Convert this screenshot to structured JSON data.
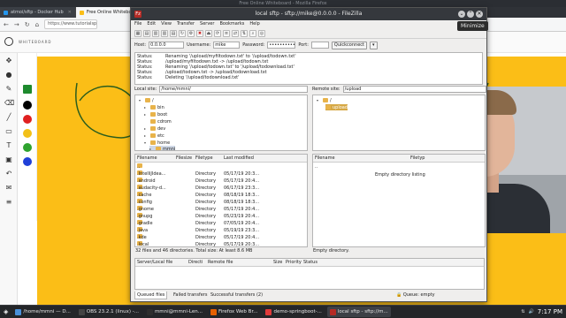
{
  "browser": {
    "title": "Free Online Whiteboard - Mozilla Firefox",
    "tabs": [
      {
        "label": "atmoi/sftp - Docker Hub",
        "active": false
      },
      {
        "label": "Free Online Whiteboard",
        "active": true
      }
    ],
    "url": "https://www.tutorialspo"
  },
  "whiteboard": {
    "brand": "WHITEBOARD",
    "canvas_color": "#fbbe17",
    "palette": [
      "#000000",
      "#e02020",
      "#f2c018",
      "#2fa32f",
      "#2040d8"
    ]
  },
  "filezilla": {
    "title": "local sftp - sftp://mike@0.0.0.0 - FileZilla",
    "menu": [
      "File",
      "Edit",
      "View",
      "Transfer",
      "Server",
      "Bookmarks",
      "Help"
    ],
    "quickconnect": {
      "host_label": "Host:",
      "host_value": "0.0.0.0",
      "username_label": "Username:",
      "username_value": "mike",
      "password_label": "Password:",
      "password_value": "••••••••••",
      "port_label": "Port:",
      "port_value": "",
      "button": "Quickconnect",
      "dropdown": "▾"
    },
    "log": [
      {
        "status": "Status:",
        "msg": "Renaming '/upload/myfiltodown.txt' to '/upload/todown.txt'"
      },
      {
        "status": "Status:",
        "msg": "/upload/myfiltodown.txt -> /upload/todown.txt"
      },
      {
        "status": "Status:",
        "msg": "Renaming '/upload/todown.txt' to '/upload/todownload.txt'"
      },
      {
        "status": "Status:",
        "msg": "/upload/todown.txt -> /upload/todownload.txt"
      },
      {
        "status": "Status:",
        "msg": "Deleting '/upload/todownload.txt'"
      }
    ],
    "local": {
      "label": "Local site:",
      "path": "/home/mmni/",
      "tree": [
        "/",
        "bin",
        "boot",
        "cdrom",
        "dev",
        "etc",
        "home",
        "mmni"
      ],
      "columns": [
        "Filename",
        "Filesize",
        "Filetype",
        "Last modified"
      ],
      "files": [
        {
          "name": "..",
          "size": "",
          "type": "",
          "modified": ""
        },
        {
          "name": ".IntelliJIdea...",
          "size": "",
          "type": "Directory",
          "modified": "05/17/19 20:3..."
        },
        {
          "name": ".android",
          "size": "",
          "type": "Directory",
          "modified": "05/17/19 20:4..."
        },
        {
          "name": ".audacity-d...",
          "size": "",
          "type": "Directory",
          "modified": "06/17/19 23:3..."
        },
        {
          "name": ".cache",
          "size": "",
          "type": "Directory",
          "modified": "08/18/19 18:3..."
        },
        {
          "name": ".config",
          "size": "",
          "type": "Directory",
          "modified": "08/18/19 18:3..."
        },
        {
          "name": ".gnome",
          "size": "",
          "type": "Directory",
          "modified": "05/17/19 20:4..."
        },
        {
          "name": ".gnupg",
          "size": "",
          "type": "Directory",
          "modified": "05/23/19 20:4..."
        },
        {
          "name": ".gradle",
          "size": "",
          "type": "Directory",
          "modified": "07/05/19 20:4..."
        },
        {
          "name": ".java",
          "size": "",
          "type": "Directory",
          "modified": "05/19/19 23:3..."
        },
        {
          "name": ".kde",
          "size": "",
          "type": "Directory",
          "modified": "05/17/19 20:4..."
        },
        {
          "name": ".local",
          "size": "",
          "type": "Directory",
          "modified": "05/17/19 20:3..."
        }
      ],
      "status": "32 files and 46 directories. Total size: At least 8.6 MB"
    },
    "remote": {
      "label": "Remote site:",
      "path": "/upload",
      "tree": [
        "/",
        "upload"
      ],
      "columns": [
        "Filename",
        "Filetyp"
      ],
      "files": [
        {
          "name": ".."
        }
      ],
      "empty_msg": "Empty directory listing",
      "status": "Empty directory."
    },
    "queue": {
      "columns": [
        "Server/Local file",
        "Directi",
        "Remote file",
        "Size",
        "Priority",
        "Status"
      ],
      "tabs": [
        "Queued files",
        "Failed transfers",
        "Successful transfers (2)"
      ],
      "status": "Queue: empty"
    },
    "tooltip": "Minimize"
  },
  "taskbar": {
    "tasks": [
      {
        "label": "/home/mmni — D...",
        "color": "#4a90d9"
      },
      {
        "label": "OBS 23.2.1 (linux) -...",
        "color": "#444"
      },
      {
        "label": "mmni@mmni-Len...",
        "color": "#2e2e2e"
      },
      {
        "label": "Firefox Web Br...",
        "color": "#e66000"
      },
      {
        "label": "demo-springboot-...",
        "color": "#e03a3a"
      },
      {
        "label": "local sftp - sftp://m...",
        "color": "#b52a25"
      }
    ],
    "clock": "7:17 PM"
  }
}
